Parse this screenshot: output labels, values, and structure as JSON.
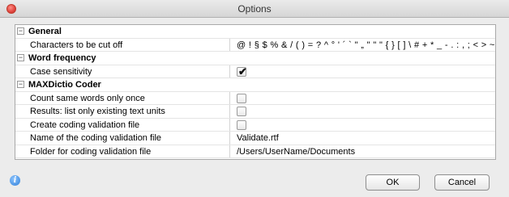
{
  "window": {
    "title": "Options"
  },
  "properties": [
    {
      "kind": "category",
      "label": "General",
      "expander": "−"
    },
    {
      "kind": "text",
      "label": "Characters to be cut off",
      "value": "@ ! § $ % & / ( ) = ? ^ ° ' ´ ` \" „ \" \" \" { } [ ] \\ # + * _ - . : , ; < > ~ —"
    },
    {
      "kind": "category",
      "label": "Word frequency",
      "expander": "−"
    },
    {
      "kind": "checkbox",
      "label": "Case sensitivity",
      "checked": true
    },
    {
      "kind": "category",
      "label": "MAXDictio Coder",
      "expander": "−"
    },
    {
      "kind": "checkbox",
      "label": "Count same words only once",
      "checked": false
    },
    {
      "kind": "checkbox",
      "label": "Results: list only existing text units",
      "checked": false
    },
    {
      "kind": "checkbox",
      "label": "Create coding validation file",
      "checked": false
    },
    {
      "kind": "text",
      "label": "Name of the coding validation file",
      "value": "Validate.rtf"
    },
    {
      "kind": "text",
      "label": "Folder for coding validation file",
      "value": "/Users/UserName/Documents"
    }
  ],
  "footer": {
    "info_icon": "i",
    "ok_label": "OK",
    "cancel_label": "Cancel"
  },
  "colors": {
    "checkbox_check": "#111111",
    "info_blue": "#2f7fd8"
  }
}
